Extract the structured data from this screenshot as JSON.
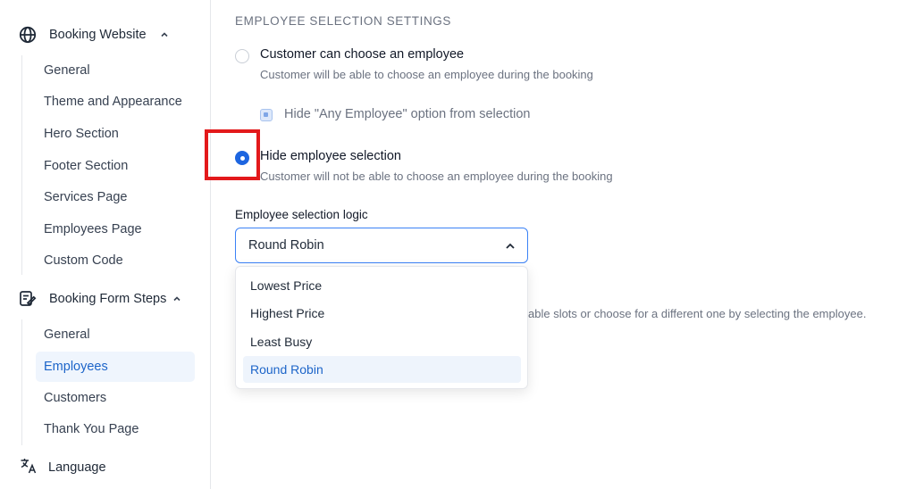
{
  "sidebar": {
    "booking_website": {
      "label": "Booking Website",
      "icon": "globe-icon",
      "items": [
        "General",
        "Theme and Appearance",
        "Hero Section",
        "Footer Section",
        "Services Page",
        "Employees Page",
        "Custom Code"
      ]
    },
    "booking_form_steps": {
      "label": "Booking Form Steps",
      "icon": "form-edit-icon",
      "items": [
        "General",
        "Employees",
        "Customers",
        "Thank You Page"
      ],
      "active_item": "Employees"
    },
    "language": {
      "label": "Language",
      "icon": "translate-icon"
    }
  },
  "main": {
    "section_title": "EMPLOYEE SELECTION SETTINGS",
    "option_choose": {
      "title": "Customer can choose an employee",
      "description": "Customer will be able to choose an employee during the booking",
      "checked": false
    },
    "hide_any_employee": {
      "label": "Hide \"Any Employee\" option from selection",
      "checked": true
    },
    "option_hide": {
      "title": "Hide employee selection",
      "description": "Customer will not be able to choose an employee during the booking",
      "checked": true
    },
    "selection_logic": {
      "label": "Employee selection logic",
      "value": "Round Robin",
      "options": [
        "Lowest Price",
        "Highest Price",
        "Least Busy",
        "Round Robin"
      ]
    },
    "background_text": "able slots or choose for a different one by selecting the employee."
  },
  "colors": {
    "accent": "#1d65e0",
    "highlight": "#e3191b"
  }
}
